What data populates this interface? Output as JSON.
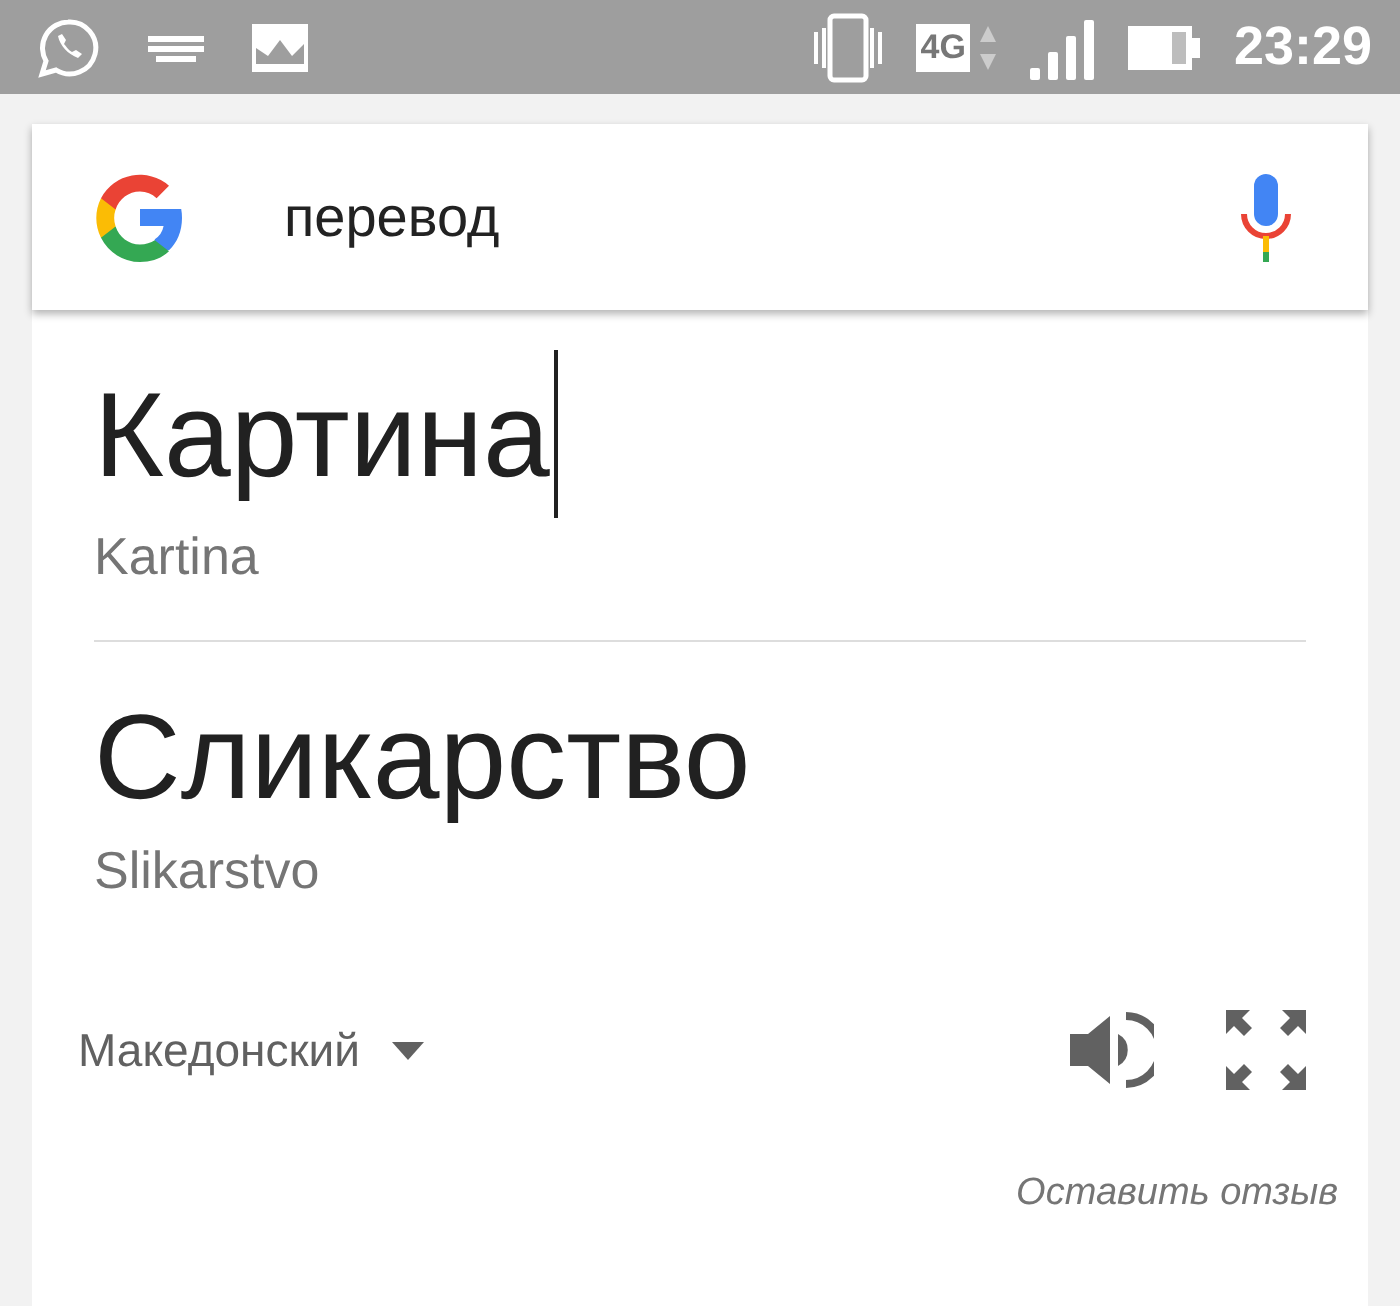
{
  "status_bar": {
    "network": "4G",
    "time": "23:29"
  },
  "search": {
    "value": "перевод"
  },
  "translation": {
    "source": {
      "text": "Картина",
      "transliteration": "Kartina"
    },
    "target": {
      "text": "Сликарство",
      "transliteration": "Slikarstvo"
    },
    "language": "Македонский",
    "feedback": "Оставить отзыв"
  }
}
